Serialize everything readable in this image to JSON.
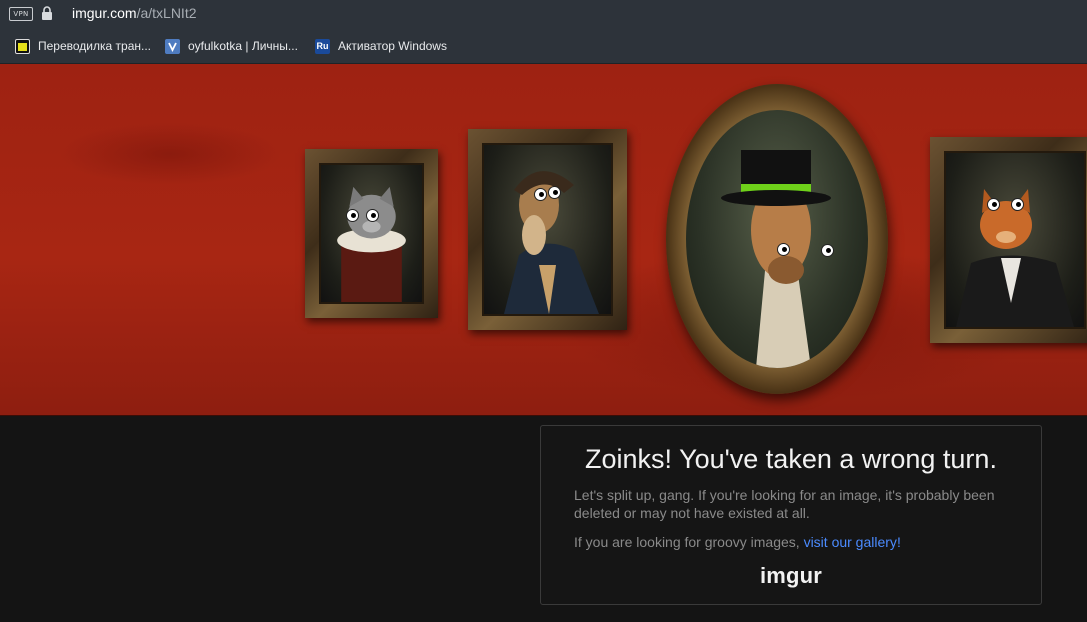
{
  "browser": {
    "vpn_label": "VPN",
    "url_host": "imgur.com",
    "url_path": "/a/txLNIt2",
    "bookmarks": [
      {
        "label": "Переводилка тран...",
        "icon": "translator-icon"
      },
      {
        "label": "oyfulkotka | Личны...",
        "icon": "v-icon"
      },
      {
        "label": "Активатор Windows",
        "icon": "ru-icon",
        "icon_text": "Ru"
      }
    ]
  },
  "banner": {
    "portraits": [
      "cat-portrait",
      "ferret-portrait",
      "giraffe-portrait",
      "orange-cat-portrait"
    ]
  },
  "error": {
    "headline": "Zoinks! You've taken a wrong turn.",
    "message": "Let's split up, gang. If you're looking for an image, it's probably been deleted or may not have existed at all.",
    "groovy_prefix": "If you are looking for groovy images, ",
    "gallery_link": "visit our gallery",
    "groovy_suffix": "!",
    "logo": "imgur"
  },
  "colors": {
    "banner_red": "#a82613",
    "link_blue": "#4b8bff",
    "background": "#141414"
  }
}
